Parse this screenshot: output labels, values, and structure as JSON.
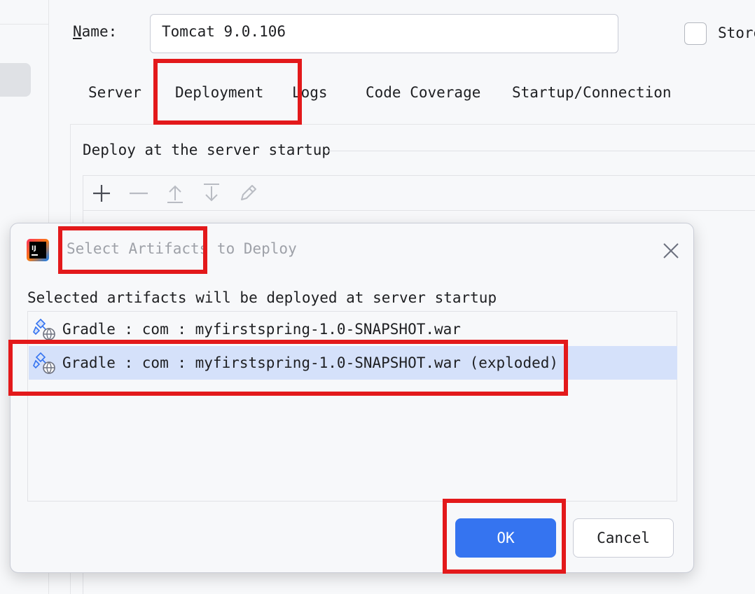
{
  "config": {
    "name_label_prefix": "N",
    "name_label_rest": "ame:",
    "name_value": "Tomcat 9.0.106",
    "store_label": "Store",
    "tabs": [
      {
        "label": "Server"
      },
      {
        "label": "Deployment"
      },
      {
        "label": "Logs"
      },
      {
        "label": "Code Coverage"
      },
      {
        "label": "Startup/Connection"
      }
    ],
    "deploy_section_title": "Deploy at the server startup",
    "toolbar_icons": [
      "add-icon",
      "remove-icon",
      "move-up-icon",
      "move-down-icon",
      "edit-icon"
    ]
  },
  "dialog": {
    "title": "Select Artifacts to Deploy",
    "description": "Selected artifacts will be deployed at server startup",
    "artifacts": [
      {
        "label": "Gradle : com : myfirstspring-1.0-SNAPSHOT.war",
        "selected": false
      },
      {
        "label": "Gradle : com : myfirstspring-1.0-SNAPSHOT.war (exploded)",
        "selected": true
      }
    ],
    "ok_label": "OK",
    "cancel_label": "Cancel"
  },
  "colors": {
    "accent": "#3574f0",
    "selection": "#d5e1fa",
    "annotation_red": "#e3191b",
    "background": "#f7f8fa"
  }
}
